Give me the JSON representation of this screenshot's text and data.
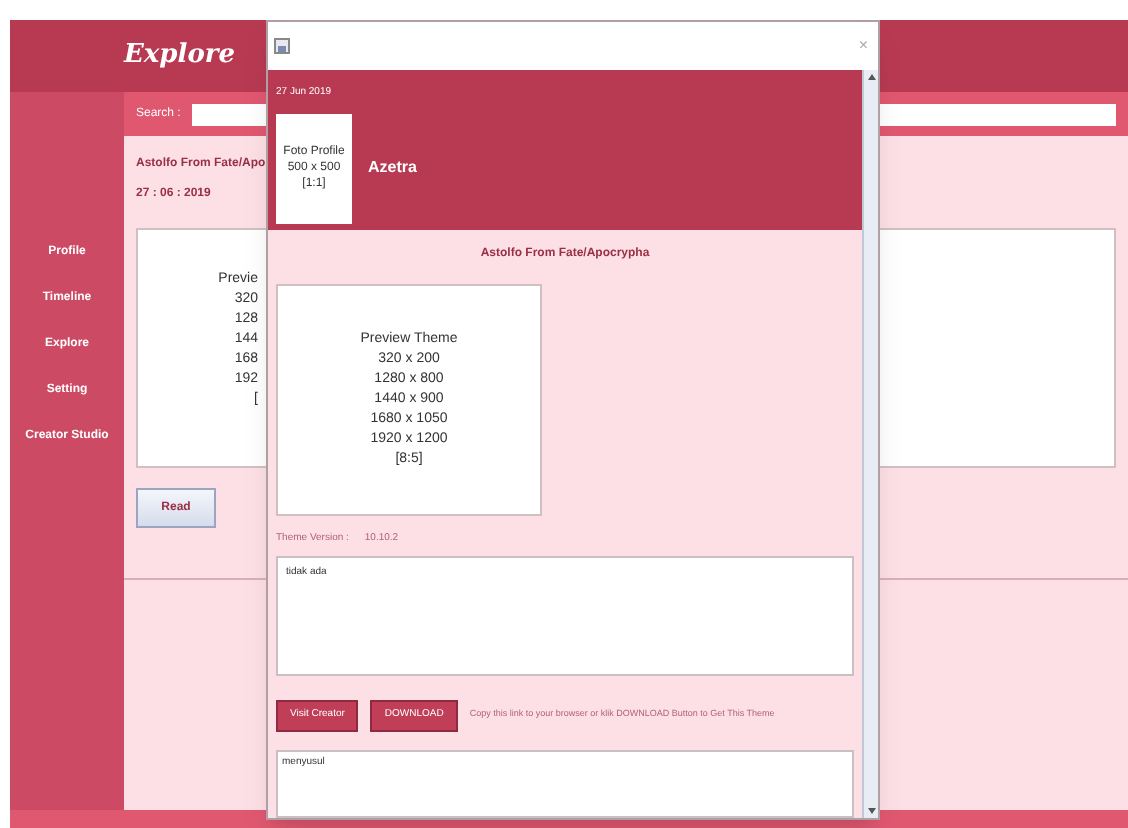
{
  "app": {
    "title": "Explore",
    "sidebar": {
      "items": [
        "Profile",
        "Timeline",
        "Explore",
        "Setting",
        "Creator Studio"
      ]
    },
    "search": {
      "label": "Search :"
    },
    "post": {
      "title": "Astolfo From Fate/Apo",
      "date": "27 : 06 : 2019",
      "preview_lines": [
        "Previe",
        "320",
        "128",
        "144",
        "168",
        "192",
        "["
      ],
      "read_button": "Read"
    }
  },
  "dialog": {
    "close": "×",
    "date": "27 Jun 2019",
    "photo_lines": [
      "Foto Profile",
      "500 x 500",
      "[1:1]"
    ],
    "author": "Azetra",
    "theme_title": "Astolfo From Fate/Apocrypha",
    "preview_lines": [
      "Preview Theme",
      "320 x 200",
      "1280 x 800",
      "1440 x 900",
      "1680 x 1050",
      "1920 x 1200",
      "[8:5]"
    ],
    "version_label": "Theme Version :",
    "version": "10.10.2",
    "description": "tidak ada",
    "buttons": [
      "Visit Creator",
      "DOWNLOAD"
    ],
    "hint": "Copy this link to your browser or klik DOWNLOAD Button to Get This Theme",
    "link": "menyusul"
  }
}
